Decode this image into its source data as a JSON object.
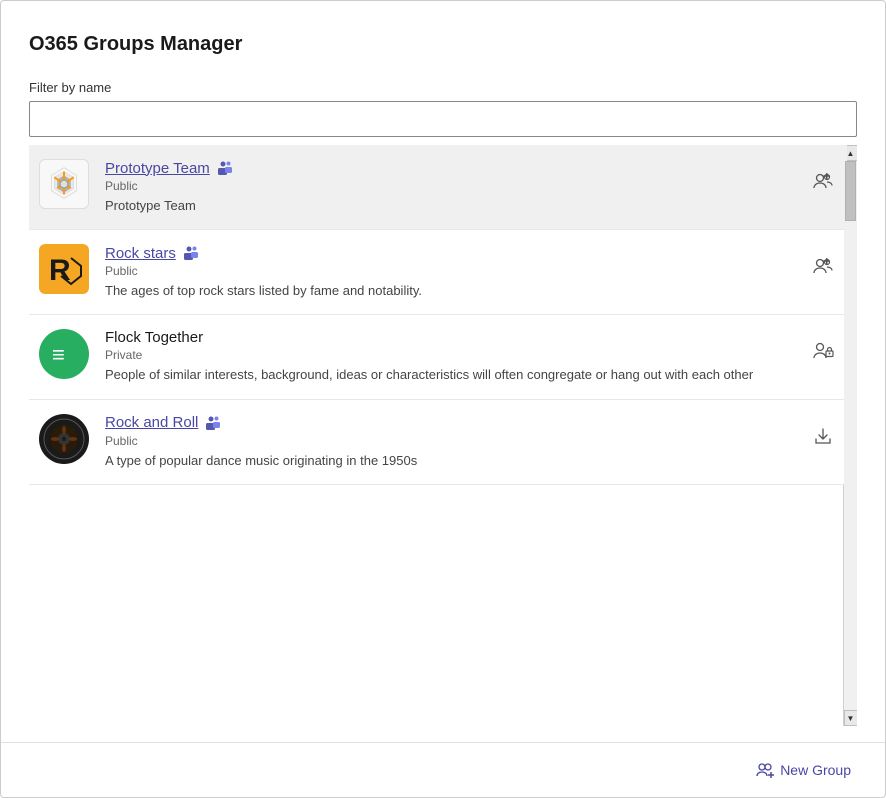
{
  "header": {
    "title": "O365 Groups Manager"
  },
  "filter": {
    "label": "Filter by name",
    "placeholder": "",
    "value": ""
  },
  "groups": [
    {
      "id": "prototype-team",
      "name": "Prototype Team",
      "hasLink": true,
      "hasTeams": true,
      "privacy": "Public",
      "description": "Prototype Team",
      "avatarType": "image",
      "avatarBg": "#f8f8f8",
      "actionIcon": "manage-members",
      "expanded": true
    },
    {
      "id": "rock-stars",
      "name": "Rock stars",
      "hasLink": true,
      "hasTeams": true,
      "privacy": "Public",
      "description": "The ages of top rock stars listed by fame and notability.",
      "avatarType": "image",
      "avatarBg": "#f5a623",
      "actionIcon": "manage-members",
      "expanded": false
    },
    {
      "id": "flock-together",
      "name": "Flock Together",
      "hasLink": false,
      "hasTeams": false,
      "privacy": "Private",
      "description": "People of similar interests, background, ideas or characteristics will often congregate or hang out with each other",
      "avatarType": "image",
      "avatarBg": "#27ae60",
      "actionIcon": "manage-private-members",
      "expanded": false
    },
    {
      "id": "rock-and-roll",
      "name": "Rock and Roll",
      "hasLink": true,
      "hasTeams": true,
      "privacy": "Public",
      "description": "A type of popular dance music originating in the 1950s",
      "avatarType": "image",
      "avatarBg": "#1a1a1a",
      "actionIcon": "download",
      "expanded": false
    }
  ],
  "footer": {
    "new_group_label": "New Group"
  }
}
